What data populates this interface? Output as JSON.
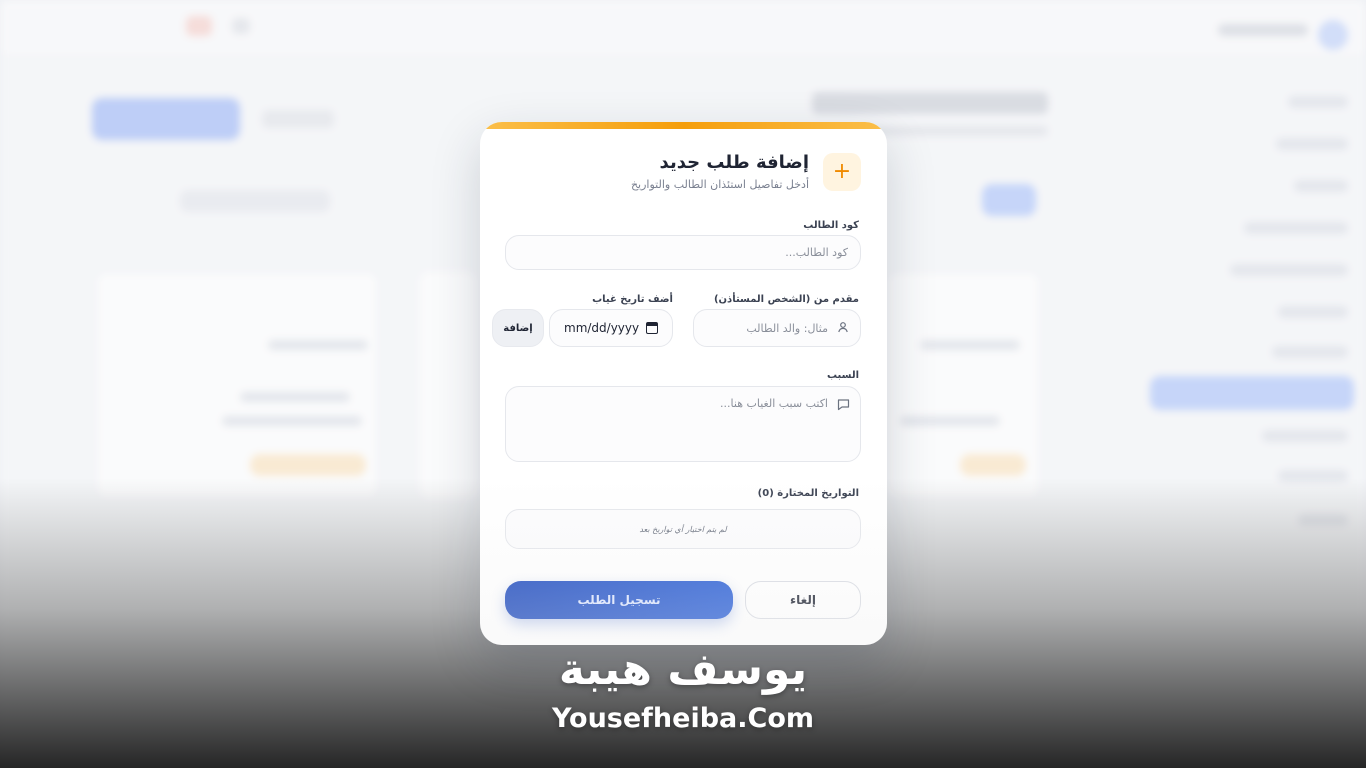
{
  "modal": {
    "icon": "plus-icon",
    "title": "إضافة طلب جديد",
    "subtitle": "أدخل تفاصيل استئذان الطالب والتواريخ",
    "student_code": {
      "label": "كود الطالب",
      "placeholder": "كود الطالب..."
    },
    "requester": {
      "label": "مقدم من (الشخص المستأذن)",
      "placeholder": "مثال: والد الطالب",
      "icon": "user-icon"
    },
    "absence_date": {
      "label": "أضف تاريخ غياب",
      "value": "mm/dd/yyyy",
      "icon": "calendar-icon"
    },
    "add_button": "إضافة",
    "reason": {
      "label": "السبب",
      "placeholder": "اكتب سبب الغياب هنا...",
      "icon": "message-icon"
    },
    "selected_dates": {
      "label": "التواريخ المختارة (0)",
      "empty_text": "لم يتم اختيار أي تواريخ بعد"
    },
    "submit_button": "تسجيل الطلب",
    "cancel_button": "إلغاء",
    "accent_color": "#f59e0b",
    "primary_color": "#1c49bd"
  },
  "watermark": {
    "arabic": "يوسف هيبة",
    "url": "Yousefheiba.Com"
  }
}
